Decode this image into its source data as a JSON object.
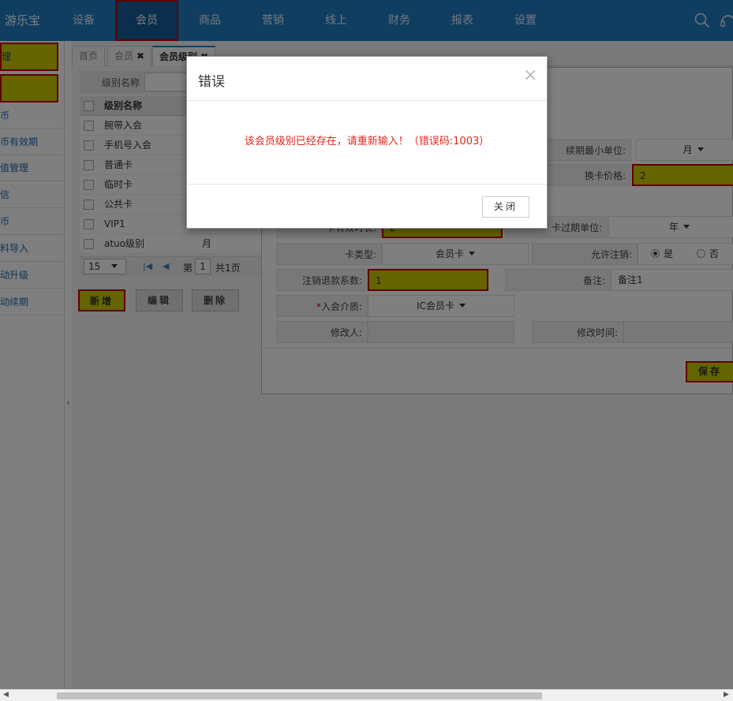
{
  "topbar": {
    "brand": "游乐宝",
    "nav": [
      "设备",
      "会员",
      "商品",
      "营销",
      "线上",
      "财务",
      "报表",
      "设置"
    ],
    "active_nav": "会员",
    "icons": [
      "search-icon",
      "headset-icon"
    ]
  },
  "sidebar": {
    "top_items": [
      "理",
      ""
    ],
    "items": [
      "币",
      "币有效期",
      "值管理",
      "信",
      "币",
      "料导入",
      "动升级",
      "动续期"
    ]
  },
  "tabs": [
    {
      "label": "首页"
    },
    {
      "label": "会员",
      "close": "✖"
    },
    {
      "label": "会员级别",
      "close": "✖"
    }
  ],
  "filter": {
    "label": "级别名称"
  },
  "grid": {
    "header": "级别名称",
    "rows": [
      {
        "name": "腕带入会",
        "time": ""
      },
      {
        "name": "手机号入会",
        "time": ""
      },
      {
        "name": "普通卡",
        "time": ""
      },
      {
        "name": "临时卡",
        "time": ""
      },
      {
        "name": "公共卡",
        "time": ""
      },
      {
        "name": "VIP1",
        "time": ""
      },
      {
        "name": "atuo级别",
        "time": "月"
      }
    ]
  },
  "pager": {
    "page_size": "15",
    "page_prefix": "第",
    "page_number": "1",
    "page_total": "共1页"
  },
  "actions": {
    "add": "新增",
    "edit": "编辑",
    "delete": "删除"
  },
  "edit_form": {
    "renew_min_unit_label": "续期最小单位:",
    "renew_min_unit_value": "月",
    "exchange_price_label": "换卡价格:",
    "exchange_price_value": "2",
    "expire_duration_label": "卡有效时长:",
    "expire_duration_value": "2",
    "expire_unit_label": "卡过期单位:",
    "expire_unit_value": "年",
    "card_type_label": "卡类型:",
    "card_type_value": "会员卡",
    "allow_cancel_label": "允许注销:",
    "allow_cancel_yes": "是",
    "allow_cancel_no": "否",
    "refund_ratio_label": "注销退款系数:",
    "refund_ratio_value": "1",
    "remark_label": "备注:",
    "remark_value": "备注1",
    "medium_label": "入会介质:",
    "medium_required": "*",
    "medium_value": "IC会员卡",
    "modifier_label": "修改人:",
    "modifier_value": "",
    "modify_time_label": "修改时间:",
    "modify_time_value": "",
    "save": "保存"
  },
  "modal": {
    "title": "错误",
    "close_x": "×",
    "message": "该会员级别已经存在，请重新输入！（错误码:1003）",
    "close_button": "关闭"
  },
  "colors": {
    "topbar": "#1e7cc3",
    "highlight": "#c8c800",
    "highlight_border": "#c00000",
    "error_text": "#e0281e"
  }
}
